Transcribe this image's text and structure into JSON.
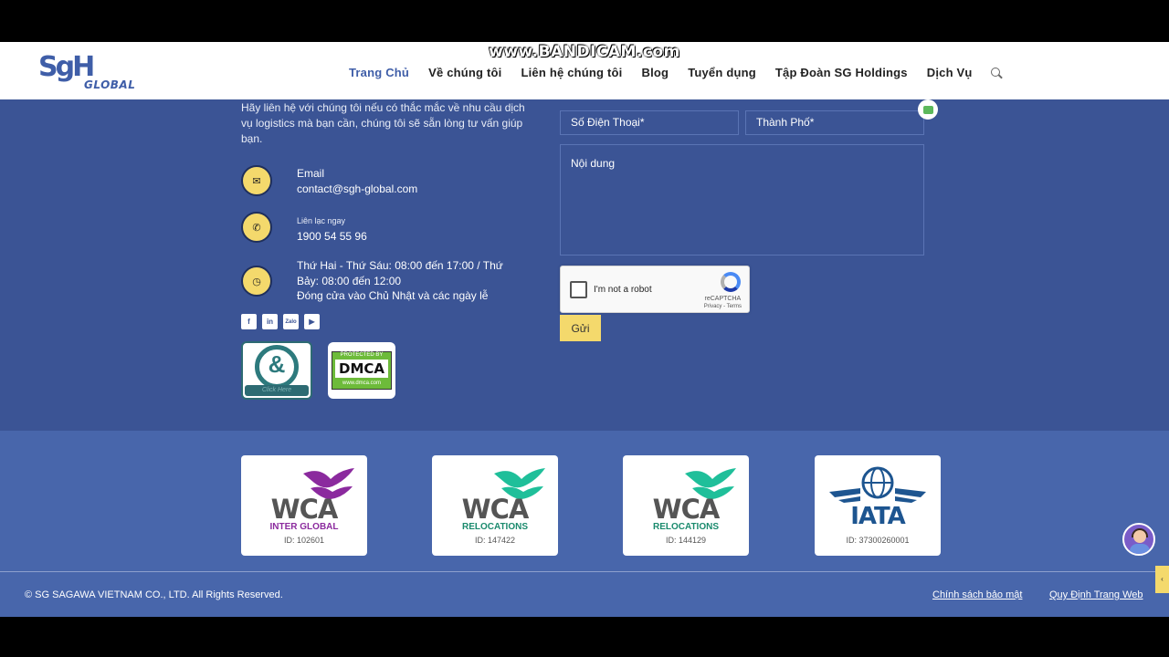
{
  "watermark": "www.BANDICAM.com",
  "header": {
    "logo_main": "SgH",
    "logo_sub": "GLOBAL",
    "nav": [
      "Trang Chủ",
      "Về chúng tôi",
      "Liên hệ chúng tôi",
      "Blog",
      "Tuyển dụng",
      "Tập Đoàn SG Holdings",
      "Dịch Vụ"
    ],
    "active_index": 0
  },
  "contact": {
    "intro": "Hãy liên hệ với chúng tôi nếu có thắc mắc về nhu cầu dịch vụ logistics mà bạn cần, chúng tôi sẽ sẵn lòng tư vấn giúp bạn.",
    "email_label": "Email",
    "email_value": "contact@sgh-global.com",
    "phone_label": "Liên lạc ngay",
    "phone_value": "1900 54 55 96",
    "hours_line1": "Thứ Hai - Thứ Sáu: 08:00 đến 17:00 / Thứ",
    "hours_line2": "Bảy: 08:00 đến 12:00",
    "hours_line3": "Đóng cửa vào Chủ Nhật và các ngày lễ",
    "social": [
      "f",
      "in",
      "Zalo",
      "▶"
    ],
    "dnb_badge": "Click Here",
    "dmca_top": "PROTECTED BY",
    "dmca_mark": "DMCA",
    "dmca_bottom": "www.dmca.com"
  },
  "form": {
    "phone_placeholder": "Số Điện Thoại*",
    "city_placeholder": "Thành Phố*",
    "content_placeholder": "Nội dung",
    "recaptcha_label": "I'm not a robot",
    "recaptcha_brand": "reCAPTCHA",
    "recaptcha_links": "Privacy - Terms",
    "submit_label": "Gửi"
  },
  "certs": [
    {
      "mark": "WCA",
      "sub": "INTER GLOBAL",
      "sub_color": "#8b2a9e",
      "bird_color": "#8b2a9e",
      "id": "ID: 102601"
    },
    {
      "mark": "WCA",
      "sub": "RELOCATIONS",
      "sub_color": "#1a8a6d",
      "bird_color": "#1fbf9a",
      "id": "ID: 147422"
    },
    {
      "mark": "WCA",
      "sub": "RELOCATIONS",
      "sub_color": "#1a8a6d",
      "bird_color": "#1fbf9a",
      "id": "ID: 144129"
    },
    {
      "mark": "IATA",
      "sub": "",
      "sub_color": "#1d5590",
      "bird_color": "#1d5590",
      "id": "ID: 37300260001"
    }
  ],
  "footer": {
    "copyright": "© SG SAGAWA VIETNAM CO., LTD. All Rights Reserved.",
    "privacy": "Chính sách bảo mật",
    "terms": "Quy Định Trang Web"
  },
  "colors": {
    "brand_blue": "#3b5495",
    "accent_yellow": "#f4d96c"
  }
}
